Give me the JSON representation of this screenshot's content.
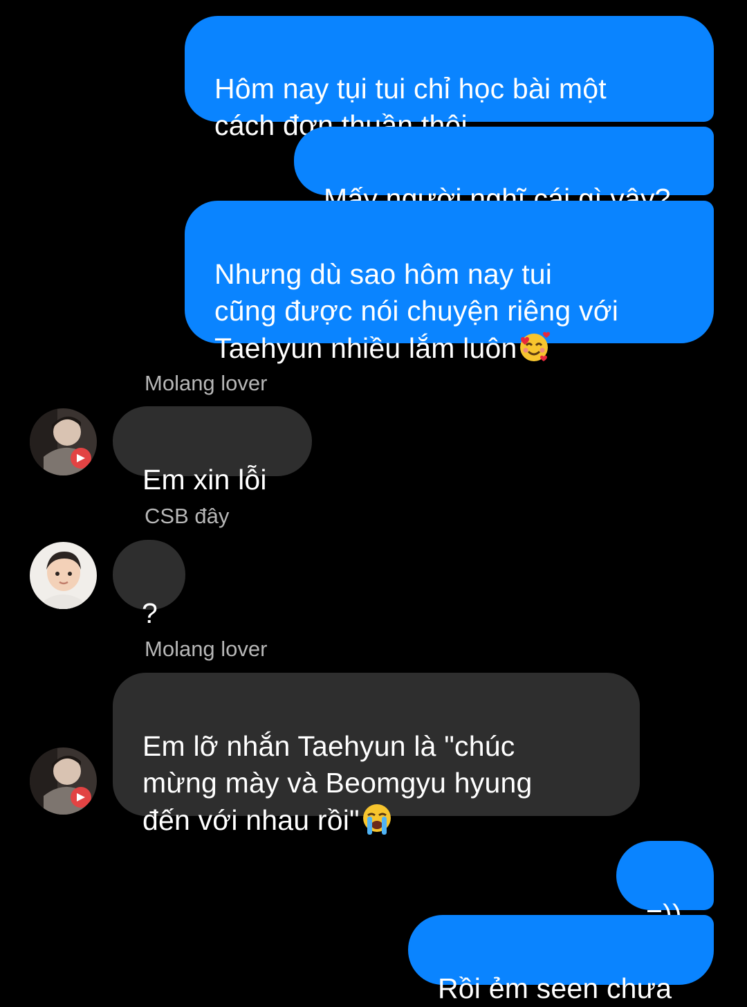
{
  "colors": {
    "background": "#000000",
    "outgoing_bubble": "#0a84ff",
    "incoming_bubble": "#2e2e2e",
    "sender_name": "#b7b7b7",
    "text": "#ffffff"
  },
  "messages": [
    {
      "direction": "outgoing",
      "text": "Hôm nay tụi tui chỉ học bài một\ncách đơn thuần thôi"
    },
    {
      "direction": "outgoing",
      "text": "Mấy người nghĩ cái gì vậy?"
    },
    {
      "direction": "outgoing",
      "text": "Nhưng dù sao hôm nay tui\ncũng được nói chuyện riêng với\nTaehyun nhiều lắm luôn",
      "emoji": "smiling-face-with-hearts"
    },
    {
      "direction": "incoming",
      "sender": "Molang lover",
      "avatar": "molang-lover-avatar",
      "text": "Em xin lỗi"
    },
    {
      "direction": "incoming",
      "sender": "CSB đây",
      "avatar": "csb-avatar",
      "text": "?"
    },
    {
      "direction": "incoming",
      "sender": "Molang lover",
      "avatar": "molang-lover-avatar",
      "text": "Em lỡ nhắn Taehyun là \"chúc\nmừng mày và Beomgyu hyung\nđến với nhau rồi\"",
      "emoji": "loudly-crying-face"
    },
    {
      "direction": "outgoing",
      "text": "=))"
    },
    {
      "direction": "outgoing",
      "text": "Rồi ẻm seen chưa"
    }
  ]
}
